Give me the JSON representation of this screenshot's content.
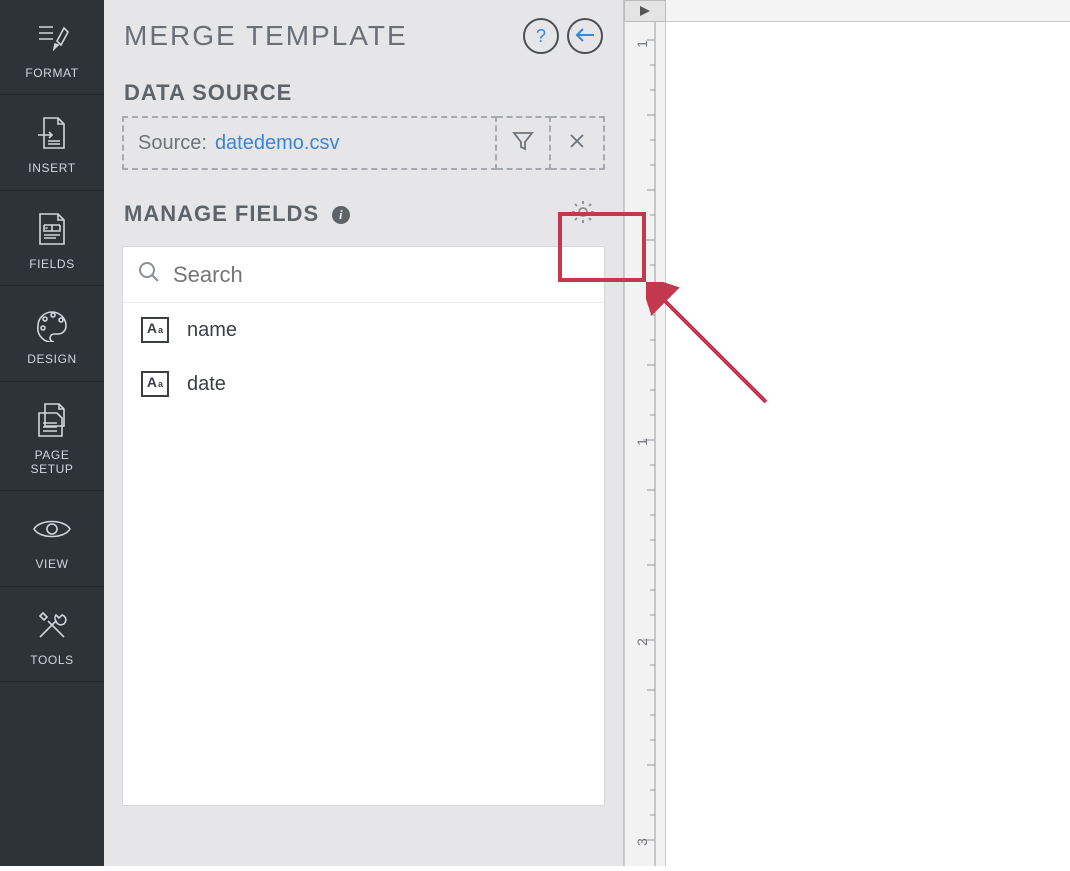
{
  "sidebar": {
    "items": [
      {
        "label": "FORMAT",
        "icon": "format-icon"
      },
      {
        "label": "INSERT",
        "icon": "insert-icon"
      },
      {
        "label": "FIELDS",
        "icon": "fields-icon"
      },
      {
        "label": "DESIGN",
        "icon": "design-icon"
      },
      {
        "label": "PAGE\nSETUP",
        "icon": "page-setup-icon"
      },
      {
        "label": "VIEW",
        "icon": "view-icon"
      },
      {
        "label": "TOOLS",
        "icon": "tools-icon"
      }
    ]
  },
  "panel": {
    "title": "MERGE TEMPLATE",
    "help_label": "?",
    "back_label": "←",
    "data_source_heading": "DATA SOURCE",
    "source_label": "Source:",
    "source_value": "datedemo.csv",
    "manage_fields_heading": "MANAGE FIELDS",
    "search_placeholder": "Search",
    "fields": [
      {
        "label": "name"
      },
      {
        "label": "date"
      }
    ]
  },
  "ruler": {
    "marks": [
      "1",
      "1",
      "2",
      "3"
    ]
  }
}
